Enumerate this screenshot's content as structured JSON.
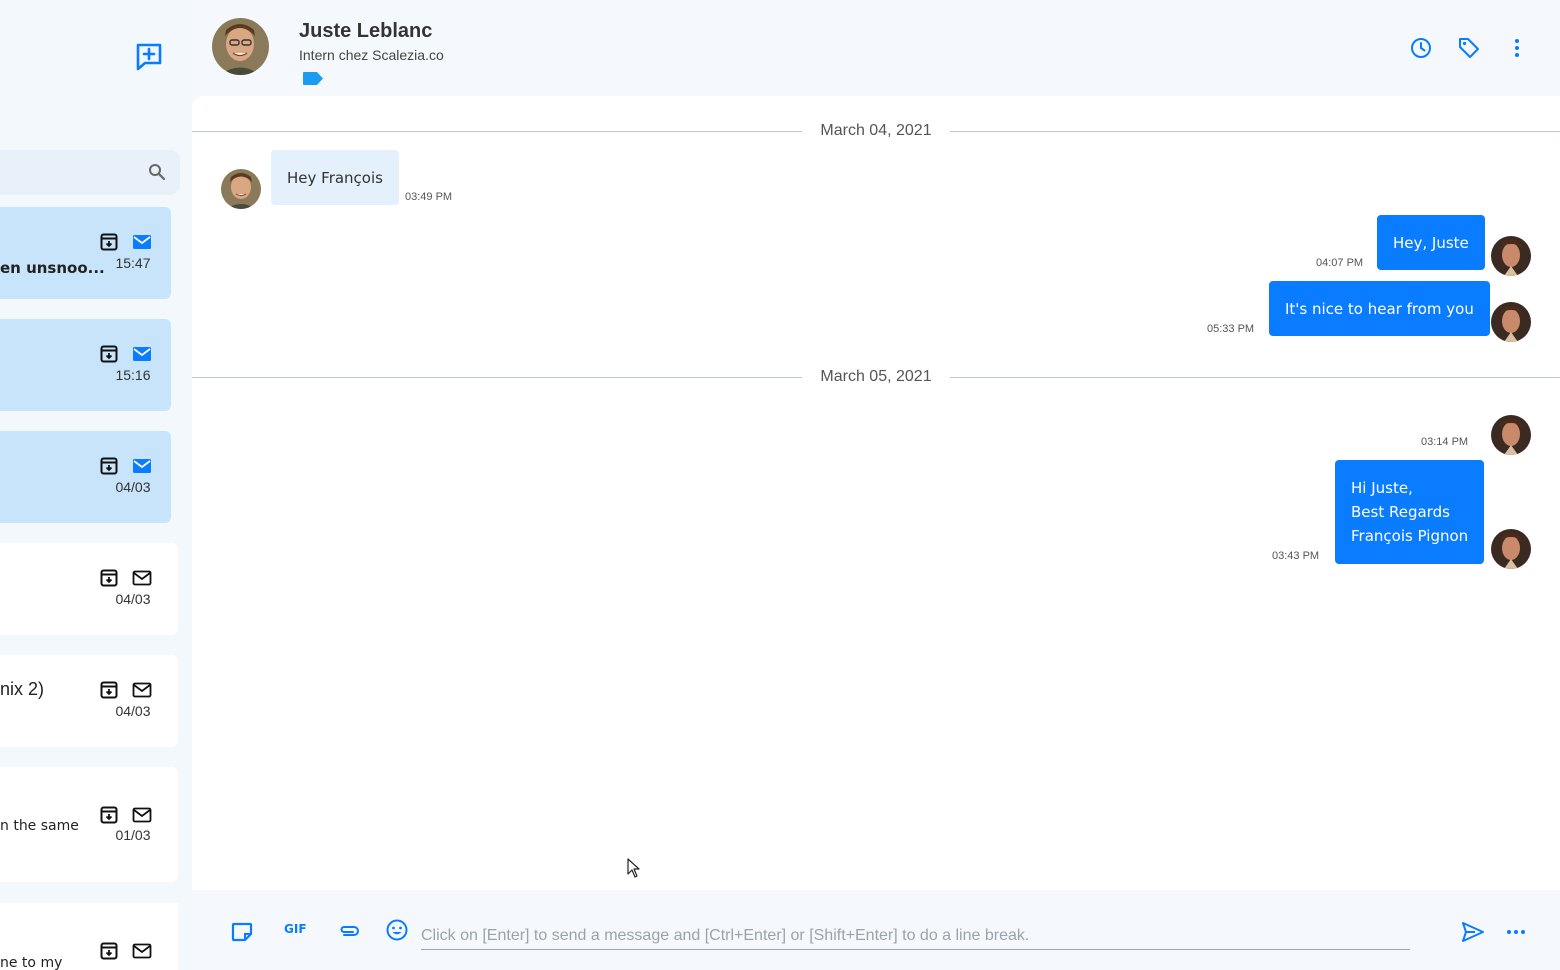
{
  "sidebar": {
    "conversations": [
      {
        "snippet": "en unsnoo...",
        "time": "15:47",
        "unread": true
      },
      {
        "snippet": "",
        "time": "15:16",
        "unread": true
      },
      {
        "snippet": "",
        "time": "04/03",
        "unread": true
      },
      {
        "snippet": "",
        "time": "04/03",
        "unread": false
      },
      {
        "snippet": "nix 2)",
        "time": "04/03",
        "unread": false
      },
      {
        "snippet": "n the same",
        "time": "01/03",
        "unread": false
      },
      {
        "snippet": "ne to my",
        "time": "",
        "unread": false
      }
    ]
  },
  "header": {
    "contact_name": "Juste Leblanc",
    "contact_subtitle": "Intern chez Scalezia.co"
  },
  "chat": {
    "dates": [
      "March 04, 2021",
      "March 05, 2021"
    ],
    "messages": [
      {
        "direction": "in",
        "lines": [
          "Hey François"
        ],
        "time": "03:49 PM"
      },
      {
        "direction": "out",
        "lines": [
          "Hey, Juste"
        ],
        "time": "04:07 PM"
      },
      {
        "direction": "out",
        "lines": [
          "It's nice to hear from you"
        ],
        "time": "05:33 PM"
      },
      {
        "direction": "out",
        "lines": [],
        "time": "03:14 PM"
      },
      {
        "direction": "out",
        "lines": [
          "Hi Juste,",
          "Best Regards",
          "François Pignon"
        ],
        "time": "03:43 PM"
      }
    ]
  },
  "composer": {
    "placeholder": "Click on [Enter] to send a message and [Ctrl+Enter] or [Shift+Enter] to do a line break.",
    "gif_label": "GIF"
  },
  "colors": {
    "accent": "#0a7cff",
    "unread_bg": "#c7e4fb",
    "tag": "#1a9cf0"
  }
}
